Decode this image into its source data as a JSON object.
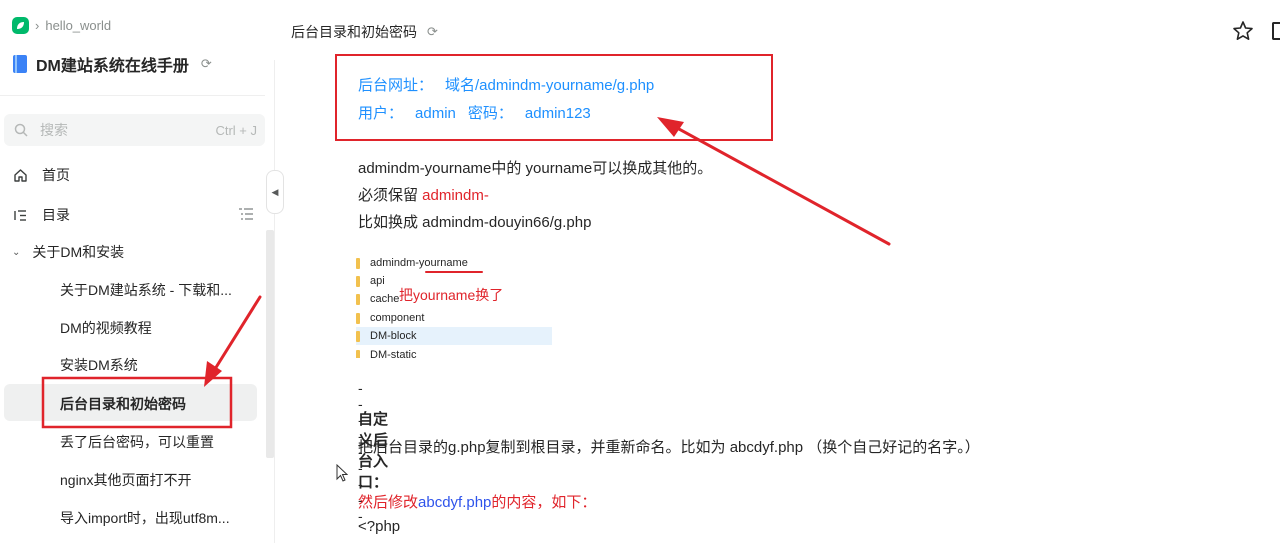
{
  "breadcrumb": {
    "repo": "hello_world"
  },
  "book": {
    "title": "DM建站系统在线手册"
  },
  "search": {
    "placeholder": "搜索",
    "shortcut": "Ctrl + J"
  },
  "nav": {
    "home": "首页",
    "toc": "目录"
  },
  "group": {
    "label": "关于DM和安装"
  },
  "docs": [
    "关于DM建站系统 - 下载和...",
    "DM的视频教程",
    "安装DM系统",
    "后台目录和初始密码",
    "丢了后台密码，可以重置",
    "nginx其他页面打不开",
    "导入import时，出现utf8m..."
  ],
  "header": {
    "title": "后台目录和初始密码"
  },
  "content": {
    "admin_url_label": "后台网址：",
    "admin_url_value": "域名/admindm-yourname/g.php",
    "user_label": "用户：",
    "user_value": "admin",
    "pwd_label": "密码：",
    "pwd_value": "admin123",
    "line1": "admindm-yourname中的 yourname可以换成其他的。",
    "line2_prefix": "必须保留 ",
    "line2_red": "admindm-",
    "line3": "比如换成 admindm-douyin66/g.php",
    "files": [
      "admindm-yourname",
      "api",
      "cache",
      "component",
      "DM-block",
      "DM-static"
    ],
    "file_note": "把yourname换了",
    "dashes": "---------",
    "section_title": "自定义后台入口：",
    "section_text": "把后台目录的g.php复制到根目录，并重新命名。比如为 abcdyf.php （换个自己好记的名字。）",
    "modify_prefix": "然后修改",
    "modify_link": "abcdyf.php",
    "modify_suffix": "的内容，如下：",
    "code_start": "<?php"
  },
  "colors": {
    "accent_red": "#e0242b",
    "info_blue": "#1e90ff",
    "brand_green": "#00b96b"
  }
}
